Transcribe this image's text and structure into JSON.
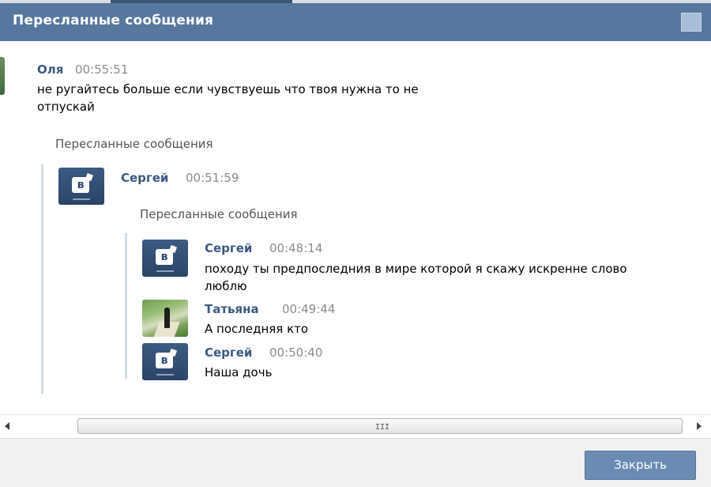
{
  "window": {
    "title": "Пересланные сообщения"
  },
  "message": {
    "author": "Оля",
    "time": "00:55:51",
    "text_line1": "не ругайтесь больше если чувствуешь что твоя нужна то не",
    "text_line2": "отпускай",
    "forwarded_label": "Пересланные сообщения",
    "forwarded": {
      "author": "Сергей",
      "time": "00:51:59",
      "forwarded_label": "Пересланные сообщения",
      "items": [
        {
          "author": "Сергей",
          "time": "00:48:14",
          "text_line1": "походу ты предпоследния в мире которой я скажу искренне слово",
          "text_line2": "люблю",
          "avatar": "vk-logo-icon"
        },
        {
          "author": "Татьяна",
          "time": "00:49:44",
          "text_line1": "А последняя кто",
          "avatar": "user-photo"
        },
        {
          "author": "Сергей",
          "time": "00:50:40",
          "text_line1": "Наша дочь",
          "avatar": "vk-logo-icon"
        }
      ]
    }
  },
  "scrollbar": {
    "grip": "III"
  },
  "footer": {
    "close_label": "Закрыть"
  }
}
